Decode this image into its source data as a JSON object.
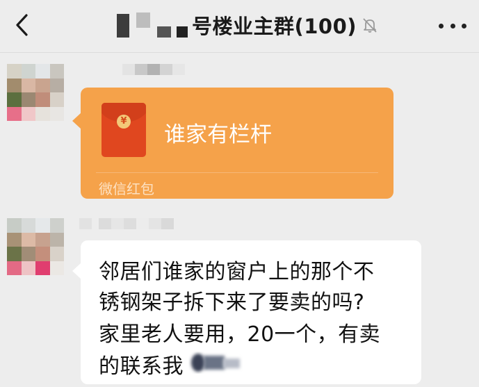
{
  "header": {
    "title": "号楼业主群(100)"
  },
  "messages": [
    {
      "type": "red_packet",
      "text": "谁家有栏杆",
      "footer": "微信红包",
      "coin_symbol": "¥"
    },
    {
      "type": "text",
      "lines": [
        "邻居们谁家的窗户上的那个不",
        "锈钢架子拆下来了要卖的吗?",
        "家里老人要用，20一个，有卖",
        "的联系我"
      ]
    }
  ],
  "colors": {
    "background": "#ededed",
    "red_packet": "#f5a24a",
    "red_packet_icon": "#e0471f",
    "bubble": "#ffffff"
  }
}
